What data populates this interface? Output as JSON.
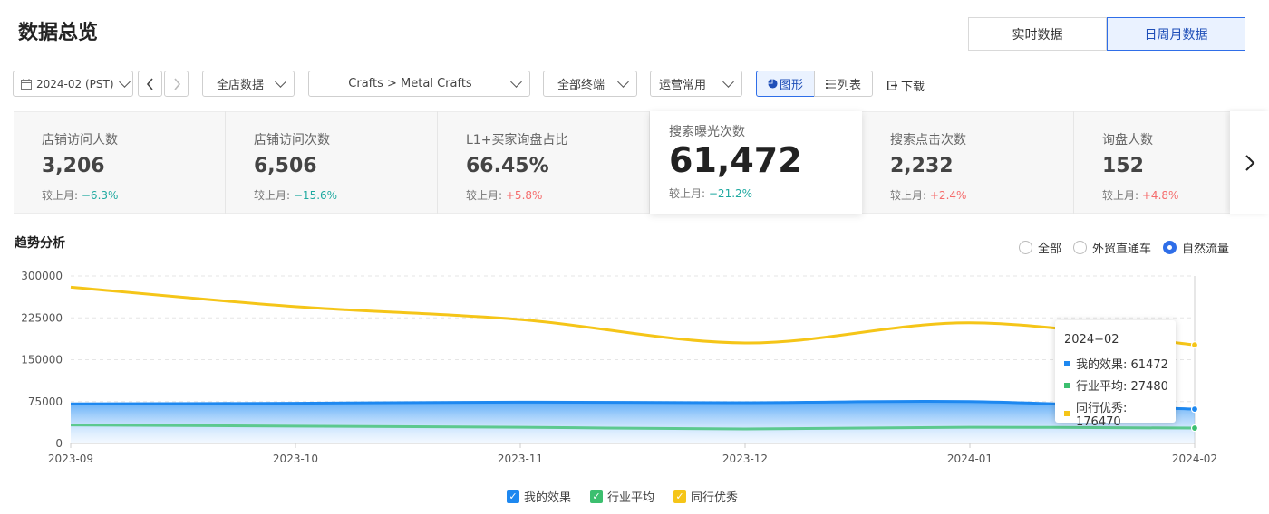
{
  "page": {
    "title": "数据总览"
  },
  "mode_toggle": {
    "realtime": "实时数据",
    "period": "日周月数据"
  },
  "filters": {
    "date": "2024-02 (PST)",
    "store_scope": "全店数据",
    "category": "Crafts > Metal Crafts",
    "terminal": "全部终端",
    "ops_preset": "运营常用",
    "view_chart": "图形",
    "view_list": "列表",
    "download": "下载"
  },
  "metrics": [
    {
      "label": "店铺访问人数",
      "value": "3,206",
      "cmp_label": "较上月:",
      "cmp": "−6.3%",
      "trend": "down"
    },
    {
      "label": "店铺访问次数",
      "value": "6,506",
      "cmp_label": "较上月:",
      "cmp": "−15.6%",
      "trend": "down"
    },
    {
      "label": "L1+买家询盘占比",
      "value": "66.45%",
      "cmp_label": "较上月:",
      "cmp": "+5.8%",
      "trend": "up"
    },
    {
      "label": "搜索曝光次数",
      "value": "61,472",
      "cmp_label": "较上月:",
      "cmp": "−21.2%",
      "trend": "down"
    },
    {
      "label": "搜索点击次数",
      "value": "2,232",
      "cmp_label": "较上月:",
      "cmp": "+2.4%",
      "trend": "up"
    },
    {
      "label": "询盘人数",
      "value": "152",
      "cmp_label": "较上月:",
      "cmp": "+4.8%",
      "trend": "up"
    }
  ],
  "trend": {
    "title": "趋势分析",
    "radio": {
      "all": "全部",
      "p4p": "外贸直通车",
      "organic": "自然流量"
    }
  },
  "tooltip": {
    "title": "2024−02",
    "rows": [
      {
        "text": "我的效果: 61472"
      },
      {
        "text": "行业平均: 27480"
      },
      {
        "text": "同行优秀: 176470"
      }
    ]
  },
  "colors": {
    "mine": "#1e88f0",
    "industry": "#5cc98f",
    "top": "#f5c518",
    "accent": "#2f6ee8"
  },
  "chart_data": {
    "type": "line",
    "categories": [
      "2023-09",
      "2023-10",
      "2023-11",
      "2023-12",
      "2024-01",
      "2024-02"
    ],
    "ylim": [
      0,
      300000
    ],
    "yticks": [
      "300000",
      "225000",
      "150000",
      "75000",
      "0"
    ],
    "series": [
      {
        "name": "我的效果",
        "values": [
          71000,
          72000,
          74000,
          73000,
          75000,
          61472
        ]
      },
      {
        "name": "行业平均",
        "values": [
          33000,
          31000,
          29000,
          26000,
          29000,
          27480
        ]
      },
      {
        "name": "同行优秀",
        "values": [
          280000,
          245000,
          222000,
          180000,
          216000,
          176470
        ]
      }
    ]
  }
}
